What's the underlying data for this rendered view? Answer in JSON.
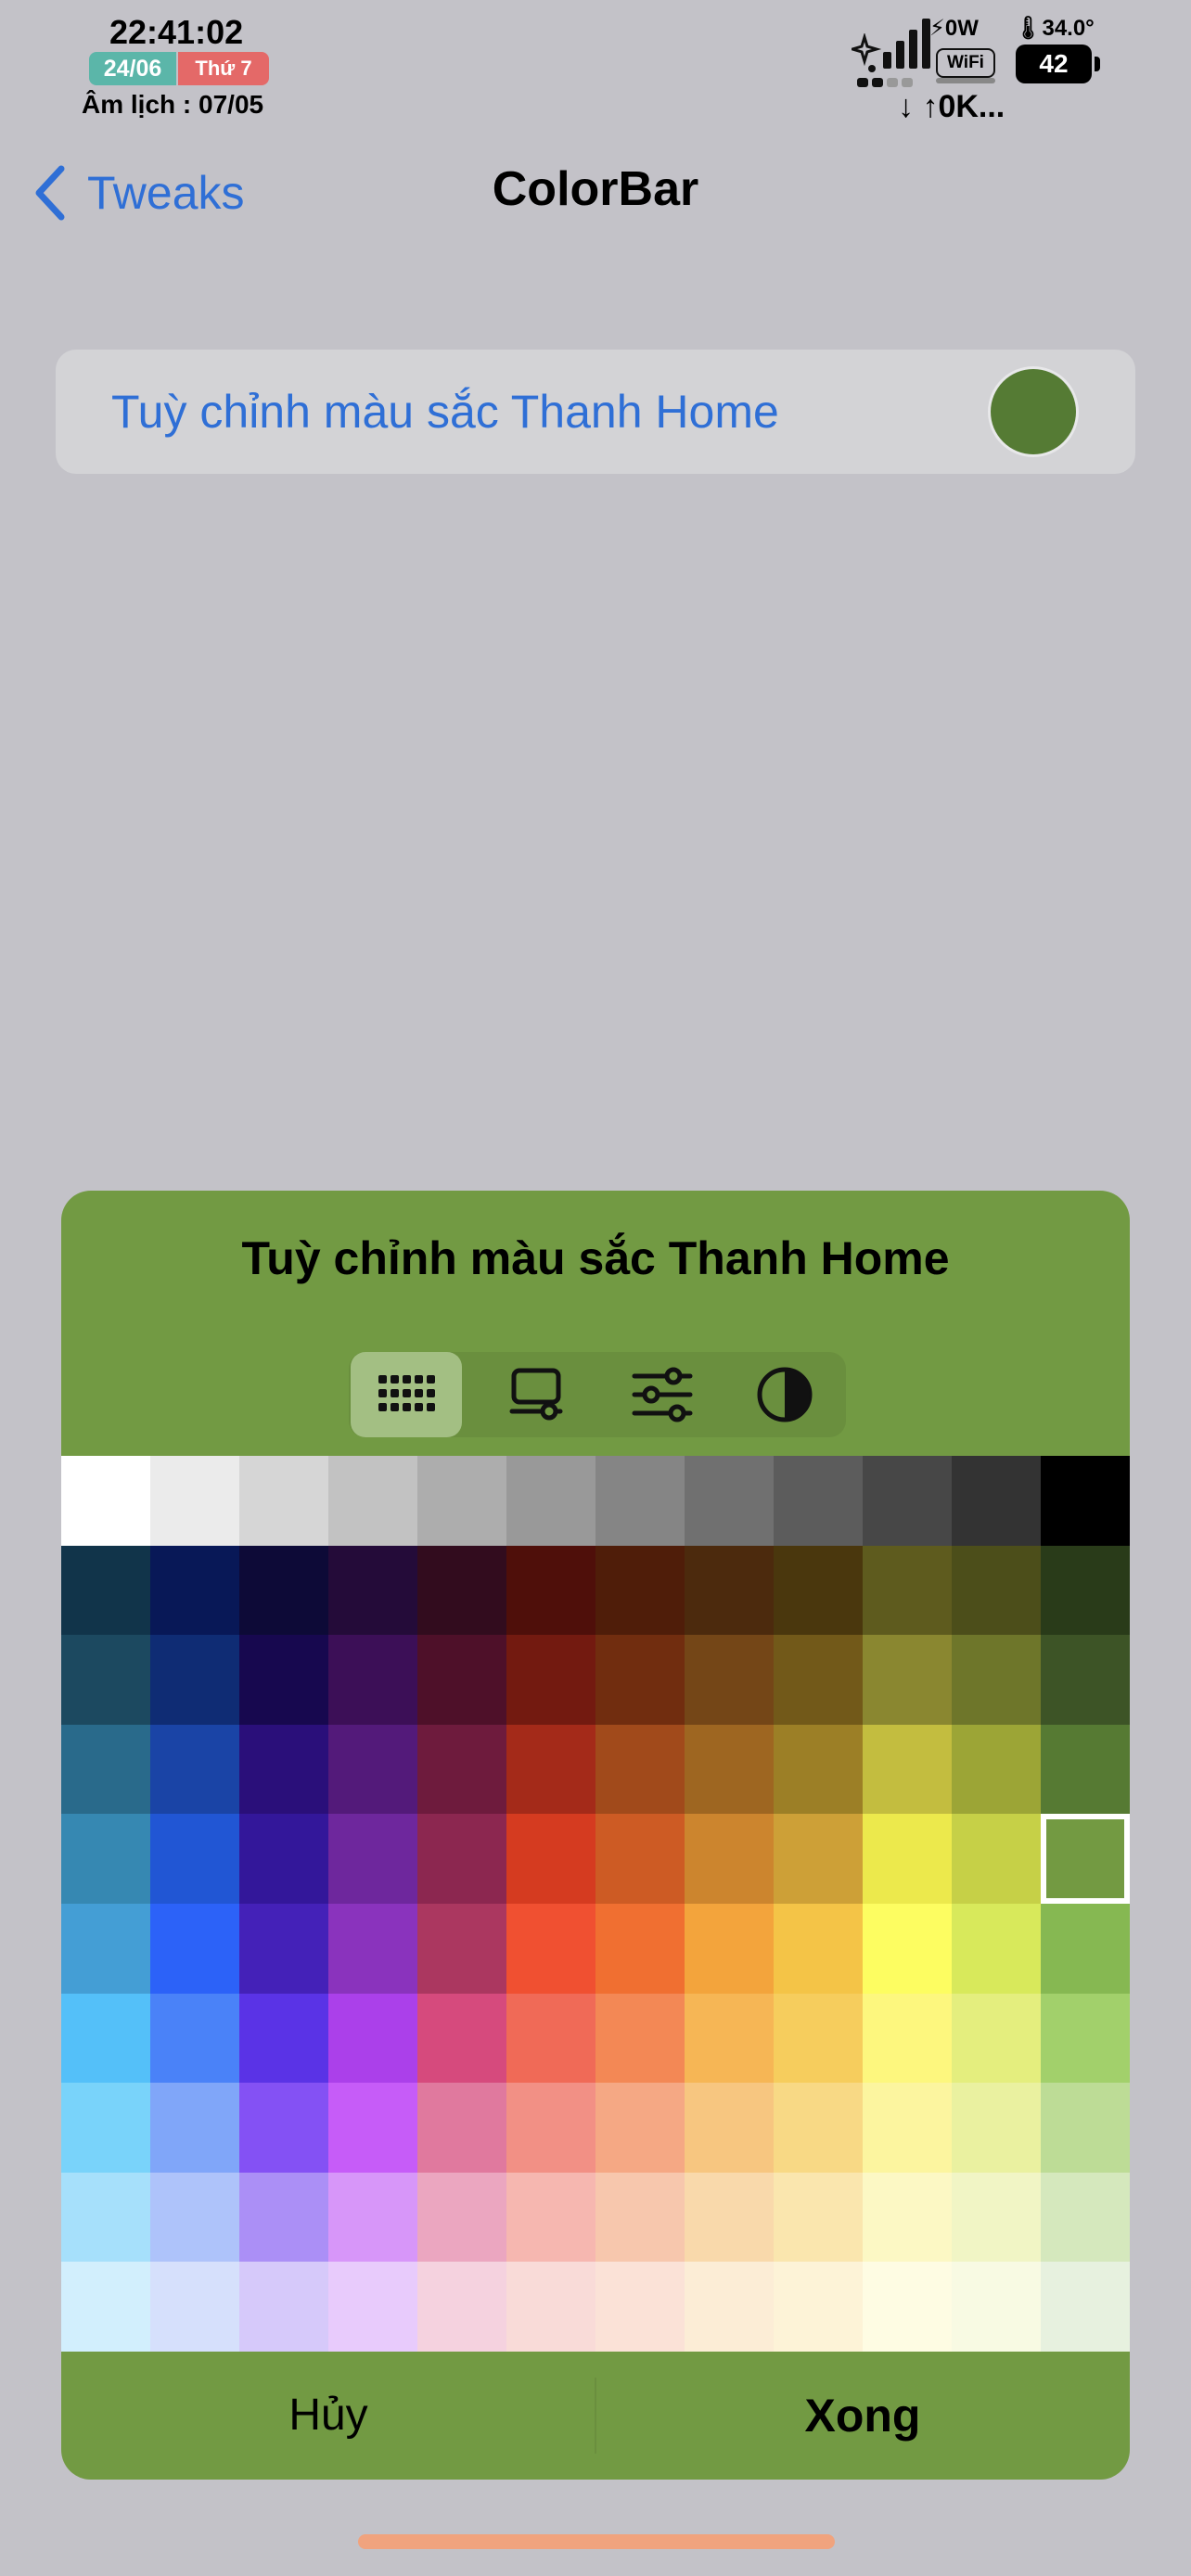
{
  "status_bar": {
    "time": "22:41:02",
    "date": "24/06",
    "weekday": "Thứ 7",
    "lunar": "Âm lịch : 07/05",
    "power": "⚡0W",
    "temperature": "🌡34.0°",
    "wifi": "WiFi",
    "battery": "42",
    "speed": "↓ ↑0K..."
  },
  "nav": {
    "back_label": "Tweaks",
    "title": "ColorBar"
  },
  "setting_row": {
    "label": "Tuỳ chỉnh màu sắc Thanh Home",
    "color": "#557b34"
  },
  "color_picker": {
    "title": "Tuỳ chỉnh màu sắc Thanh Home",
    "background": "#729a43",
    "tabs": [
      {
        "name": "grid-tab",
        "icon": "grid-icon",
        "active": true
      },
      {
        "name": "spectrum-tab",
        "icon": "spectrum-icon",
        "active": false
      },
      {
        "name": "sliders-tab",
        "icon": "sliders-icon",
        "active": false
      },
      {
        "name": "opacity-tab",
        "icon": "half-circle-icon",
        "active": false
      }
    ],
    "grid": [
      [
        "#ffffff",
        "#ebebeb",
        "#d6d6d6",
        "#c2c2c2",
        "#adadad",
        "#999999",
        "#858585",
        "#707070",
        "#5c5c5c",
        "#474747",
        "#333333",
        "#000000"
      ],
      [
        "#11344a",
        "#081857",
        "#0d0a37",
        "#240b39",
        "#320c1e",
        "#4f0f0a",
        "#4f1d09",
        "#4c2a0d",
        "#4a370d",
        "#5e5b1e",
        "#4c4e1a",
        "#293b19"
      ],
      [
        "#1c4960",
        "#0f2c74",
        "#17084f",
        "#3c0f57",
        "#4e1029",
        "#731a10",
        "#712d0f",
        "#744617",
        "#725919",
        "#8a8730",
        "#6e762a",
        "#3d5426"
      ],
      [
        "#296a8b",
        "#1a44a6",
        "#2a0f7a",
        "#531a7a",
        "#6e1b3d",
        "#a42a19",
        "#a14a1b",
        "#9e6621",
        "#9c7f26",
        "#c3bd3f",
        "#9ca536",
        "#567a33"
      ],
      [
        "#3688b2",
        "#2156d4",
        "#33179a",
        "#6e279d",
        "#8c2750",
        "#d53b20",
        "#cd5b24",
        "#cc852e",
        "#cda037",
        "#ece94c",
        "#c6d047",
        "#739a42"
      ],
      [
        "#449ed5",
        "#2c62f8",
        "#4421b8",
        "#8a33bd",
        "#ab3760",
        "#f05031",
        "#f06f31",
        "#f3a43c",
        "#f4c447",
        "#fdfd61",
        "#d8e95b",
        "#86b852"
      ],
      [
        "#54c0f9",
        "#4a82f8",
        "#5a33e6",
        "#ab40ea",
        "#d64a7d",
        "#f06a57",
        "#f38855",
        "#f6b655",
        "#f6cd5d",
        "#fdf77e",
        "#e4ee7e",
        "#a2d06b"
      ],
      [
        "#79d3fa",
        "#80a6f9",
        "#8451f4",
        "#c65cf8",
        "#e0799e",
        "#f29085",
        "#f5a884",
        "#f7c680",
        "#f8d985",
        "#fcf59f",
        "#eaf1a0",
        "#bddc96"
      ],
      [
        "#a6e0fb",
        "#aec3fa",
        "#ab8ff6",
        "#d796f9",
        "#eba6c0",
        "#f6b7b0",
        "#f7c7ad",
        "#f9d9ab",
        "#fae6ae",
        "#fcf8c4",
        "#f1f5c5",
        "#d5e8bd"
      ],
      [
        "#d2effd",
        "#d6e0fc",
        "#d6c9fa",
        "#e8cbfc",
        "#f5d2df",
        "#f9dbd8",
        "#fbe2d7",
        "#fcedd6",
        "#fdf3d7",
        "#fefce3",
        "#f8fae3",
        "#e7f1df"
      ]
    ],
    "selected": {
      "row": 4,
      "col": 11
    },
    "cancel_label": "Hủy",
    "done_label": "Xong"
  }
}
